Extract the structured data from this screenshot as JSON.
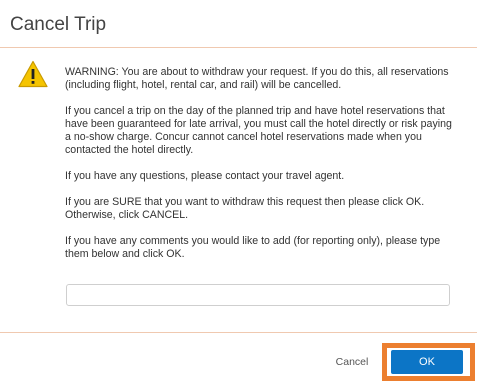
{
  "dialog": {
    "title": "Cancel Trip",
    "icon": "warning-triangle-icon",
    "paragraphs": [
      "WARNING: You are about to withdraw your request. If you do this, all reservations (including flight, hotel, rental car, and rail) will be cancelled.",
      "If you cancel a trip on the day of the planned trip and have hotel reservations that have been guaranteed for late arrival, you must call the hotel directly or risk paying a no-show charge. Concur cannot cancel hotel reservations made when you contacted the hotel directly.",
      "If you have any questions, please contact your travel agent.",
      "If you are SURE that you want to withdraw this request then please click OK. Otherwise, click CANCEL.",
      "If you have any comments you would like to add (for reporting only), please type them below and click OK."
    ],
    "comment_value": "",
    "cancel_label": "Cancel",
    "ok_label": "OK"
  },
  "colors": {
    "ok_button": "#0c75c6",
    "highlight": "#ec7f2f",
    "warning_icon": "#f5c400"
  }
}
